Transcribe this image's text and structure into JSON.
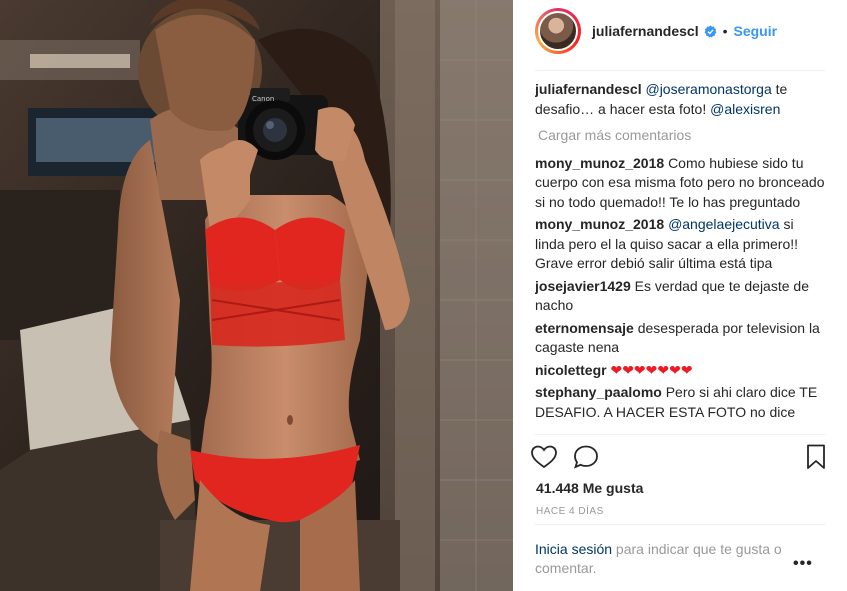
{
  "post": {
    "username": "juliafernandescl",
    "follow_label": "Seguir",
    "dot": "•"
  },
  "caption": {
    "user": "juliafernandescl",
    "mention1": "@joseramonastorga",
    "text": " te desafio… a hacer esta foto! ",
    "mention2": "@alexisren"
  },
  "load_more": "Cargar más comentarios",
  "comments": [
    {
      "user": "mony_munoz_2018",
      "mention": "",
      "text": "Como hubiese sido tu cuerpo con esa misma foto pero no bronceado si no todo quemado!! Te lo has preguntado"
    },
    {
      "user": "mony_munoz_2018",
      "mention": "@angelaejecutiva",
      "text": " si linda pero el la quiso sacar a ella primero!! Grave error debió salir última está tipa"
    },
    {
      "user": "josejavier1429",
      "mention": "",
      "text": "Es verdad que te dejaste de nacho"
    },
    {
      "user": "eternomensaje",
      "mention": "",
      "text": "desesperada por television la cagaste nena"
    },
    {
      "user": "nicolettegr",
      "mention": "",
      "text": "❤❤❤❤❤❤❤"
    },
    {
      "user": "stephany_paalomo",
      "mention": "",
      "text": "Pero si ahi claro dice TE DESAFIO. A HACER ESTA FOTO no dice"
    }
  ],
  "likes": "41.448 Me gusta",
  "time": "HACE 4 DÍAS",
  "login": {
    "link": "Inicia sesión",
    "text": " para indicar que te gusta o comentar."
  },
  "options": "•••",
  "icons": {
    "verified": "verified-badge-icon",
    "like": "heart-icon",
    "comment": "comment-bubble-icon",
    "save": "bookmark-icon"
  },
  "colors": {
    "accent": "#3897f0",
    "mention": "#003569",
    "muted": "#999999",
    "heart": "#ed1c24",
    "lingerie": "#e0261e"
  }
}
